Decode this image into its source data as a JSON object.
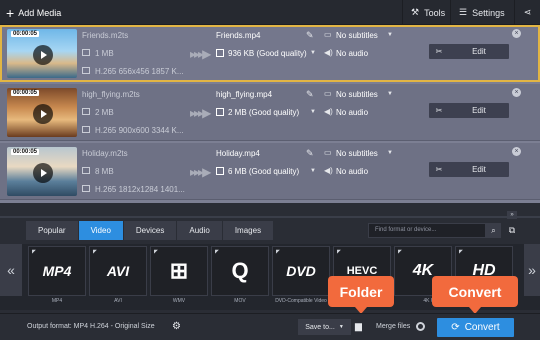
{
  "toolbar": {
    "add_media": "Add Media",
    "tools": "Tools",
    "settings": "Settings"
  },
  "files": [
    {
      "thumb_time": "00:00:05",
      "source_name": "Friends.m2ts",
      "source_size": "1 MB",
      "source_codec": "H.265 656x456 1857 K...",
      "output_name": "Friends.mp4",
      "output_size": "936 KB (Good quality)",
      "subtitles": "No subtitles",
      "audio": "No audio",
      "edit": "Edit"
    },
    {
      "thumb_time": "00:00:05",
      "source_name": "high_flying.m2ts",
      "source_size": "2 MB",
      "source_codec": "H.265 900x600 3344 K...",
      "output_name": "high_flying.mp4",
      "output_size": "2 MB (Good quality)",
      "subtitles": "No subtitles",
      "audio": "No audio",
      "edit": "Edit"
    },
    {
      "thumb_time": "00:00:05",
      "source_name": "Holiday.m2ts",
      "source_size": "8 MB",
      "source_codec": "H.265 1812x1284 1401...",
      "output_name": "Holiday.mp4",
      "output_size": "6 MB (Good quality)",
      "subtitles": "No subtitles",
      "audio": "No audio",
      "edit": "Edit"
    }
  ],
  "tabs": [
    "Popular",
    "Video",
    "Devices",
    "Audio",
    "Images"
  ],
  "active_tab": "Video",
  "search": {
    "placeholder": "Find format or device..."
  },
  "presets": [
    {
      "logo": "MP4",
      "label": "MP4"
    },
    {
      "logo": "AVI",
      "label": "AVI"
    },
    {
      "logo": "⊞",
      "label": "WMV"
    },
    {
      "logo": "Q",
      "label": "MOV"
    },
    {
      "logo": "DVD",
      "label": "DVD-Compatible Video"
    },
    {
      "logo": "HEVC",
      "label": ""
    },
    {
      "logo": "4K",
      "label": "4K Ultra HD"
    },
    {
      "logo": "HD",
      "label": ""
    }
  ],
  "bottom": {
    "output_format": "Output format: MP4 H.264 - Original Size",
    "save_to": "Save to...",
    "merge_files": "Merge files",
    "convert": "Convert"
  },
  "callouts": {
    "folder": "Folder",
    "convert": "Convert"
  },
  "colors": {
    "accent": "#2d8ee0",
    "callout": "#f26a3d",
    "selection": "#e2b544"
  }
}
